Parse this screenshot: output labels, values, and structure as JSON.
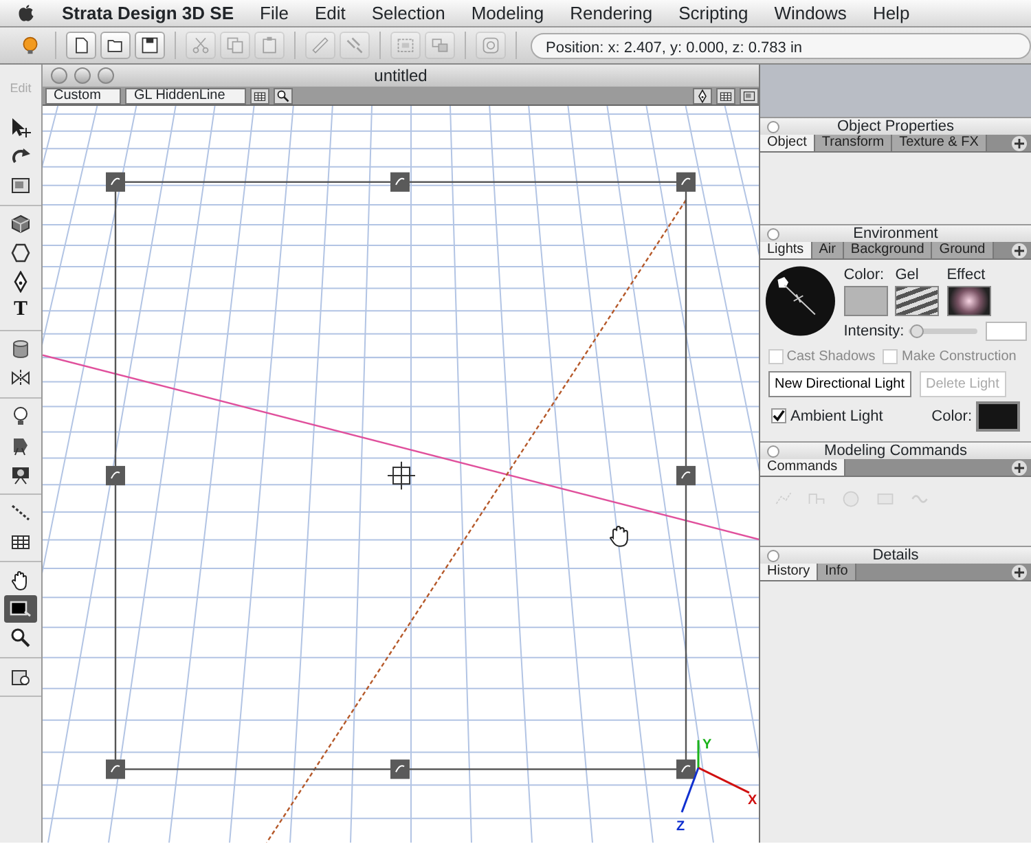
{
  "menu_bar": {
    "app": "Strata Design 3D SE",
    "items": [
      "File",
      "Edit",
      "Selection",
      "Modeling",
      "Rendering",
      "Scripting",
      "Windows",
      "Help"
    ]
  },
  "toolbar": {
    "groups": [
      {
        "buttons": [
          {
            "kind": "bulb",
            "disabled": false
          }
        ]
      },
      {
        "buttons": [
          {
            "kind": "new",
            "disabled": false
          },
          {
            "kind": "open",
            "disabled": false
          },
          {
            "kind": "save",
            "disabled": false
          }
        ]
      },
      {
        "buttons": [
          {
            "kind": "cut",
            "disabled": true
          },
          {
            "kind": "copy",
            "disabled": true
          },
          {
            "kind": "paste",
            "disabled": true
          }
        ]
      },
      {
        "buttons": [
          {
            "kind": "ruler",
            "disabled": true
          },
          {
            "kind": "link",
            "disabled": true
          }
        ]
      },
      {
        "buttons": [
          {
            "kind": "group",
            "disabled": true
          },
          {
            "kind": "ungroup",
            "disabled": true
          }
        ]
      },
      {
        "buttons": [
          {
            "kind": "center",
            "disabled": true
          }
        ]
      }
    ],
    "position": "Position:  x: 2.407,  y: 0.000,  z: 0.783 in"
  },
  "tool_palette": {
    "label": "Edit",
    "groups": [
      {
        "tools": [
          {
            "kind": "select",
            "selected": false
          },
          {
            "kind": "rotate",
            "selected": false
          },
          {
            "kind": "frame",
            "selected": false
          }
        ]
      },
      {
        "tools": [
          {
            "kind": "cube",
            "selected": false
          },
          {
            "kind": "polygon",
            "selected": false
          },
          {
            "kind": "pen",
            "selected": false
          },
          {
            "kind": "text",
            "label": "T",
            "selected": false
          }
        ]
      },
      {
        "tools": [
          {
            "kind": "cylinder",
            "selected": false
          },
          {
            "kind": "mirror",
            "selected": false
          }
        ]
      },
      {
        "tools": [
          {
            "kind": "bulb",
            "selected": false
          },
          {
            "kind": "spotlight",
            "selected": false
          },
          {
            "kind": "camera",
            "selected": false
          }
        ]
      },
      {
        "tools": [
          {
            "kind": "path",
            "selected": false
          },
          {
            "kind": "grid",
            "selected": false
          }
        ]
      },
      {
        "tools": [
          {
            "kind": "hand",
            "selected": false
          },
          {
            "kind": "render",
            "selected": true
          },
          {
            "kind": "zoom",
            "selected": false
          }
        ]
      },
      {
        "tools": [
          {
            "kind": "resource",
            "selected": false
          }
        ]
      }
    ]
  },
  "document": {
    "title": "untitled",
    "render_mode": "Custom",
    "display_mode": "GL HiddenLine",
    "axes": [
      "Y",
      "X",
      "Z"
    ]
  },
  "panels": [
    {
      "kind": "object",
      "title": "Object Properties",
      "tabs": [
        {
          "label": "Object",
          "selected": true
        },
        {
          "label": "Transform",
          "selected": false
        },
        {
          "label": "Texture & FX",
          "selected": false
        }
      ]
    },
    {
      "kind": "environment",
      "title": "Environment",
      "tabs": [
        {
          "label": "Lights",
          "selected": true
        },
        {
          "label": "Air",
          "selected": false
        },
        {
          "label": "Background",
          "selected": false
        },
        {
          "label": "Ground",
          "selected": false
        }
      ],
      "swatches": [
        {
          "kind": "color",
          "label": "Color:"
        },
        {
          "kind": "gel",
          "label": "Gel"
        },
        {
          "kind": "effect",
          "label": "Effect"
        }
      ],
      "intensity": {
        "label": "Intensity:",
        "level": 0.04
      },
      "options": [
        {
          "label": "Cast Shadows",
          "checked": false,
          "disabled": true
        },
        {
          "label": "Make Construction",
          "checked": false,
          "disabled": true
        }
      ],
      "buttons": [
        {
          "label": "New Directional Light",
          "disabled": false
        },
        {
          "label": "Delete Light",
          "disabled": true
        }
      ],
      "ambient": {
        "label": "Ambient Light",
        "checked": true,
        "color_label": "Color:"
      }
    },
    {
      "kind": "modeling",
      "title": "Modeling Commands",
      "tabs": [
        {
          "label": "Commands",
          "selected": true
        }
      ],
      "commands": [
        {
          "kind": "points"
        },
        {
          "kind": "fold"
        },
        {
          "kind": "sphere"
        },
        {
          "kind": "box"
        },
        {
          "kind": "wave"
        }
      ]
    },
    {
      "kind": "details",
      "title": "Details",
      "tabs": [
        {
          "label": "History",
          "selected": true
        },
        {
          "label": "Info",
          "selected": false
        }
      ]
    }
  ]
}
